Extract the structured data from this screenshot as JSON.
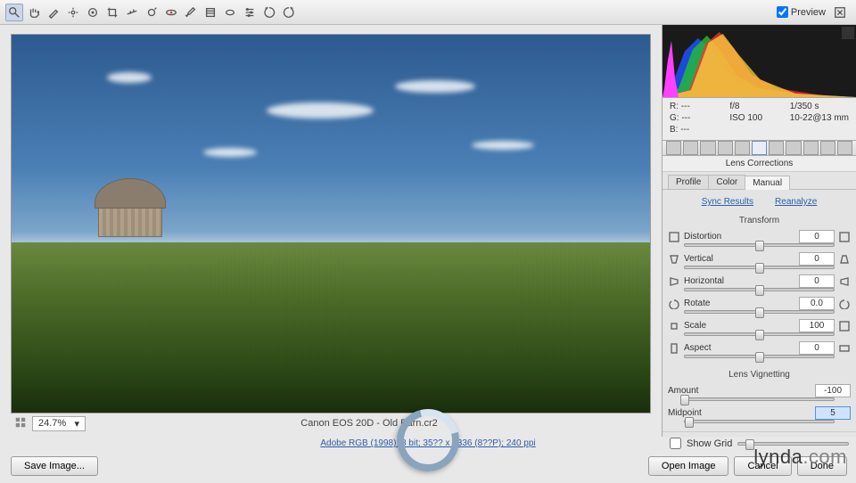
{
  "toolbar": {
    "preview_checkbox": "Preview"
  },
  "exif": {
    "r": "R:  ---",
    "g": "G:  ---",
    "b": "B:  ---",
    "aperture": "f/8",
    "shutter": "1/350 s",
    "iso": "ISO 100",
    "lens": "10-22@13 mm"
  },
  "panel": {
    "title": "Lens Corrections",
    "tabs": {
      "profile": "Profile",
      "color": "Color",
      "manual": "Manual"
    },
    "sync": "Sync Results",
    "reanalyze": "Reanalyze",
    "transform": {
      "heading": "Transform",
      "distortion": {
        "label": "Distortion",
        "value": "0",
        "pos": 50
      },
      "vertical": {
        "label": "Vertical",
        "value": "0",
        "pos": 50
      },
      "horizontal": {
        "label": "Horizontal",
        "value": "0",
        "pos": 50
      },
      "rotate": {
        "label": "Rotate",
        "value": "0.0",
        "pos": 50
      },
      "scale": {
        "label": "Scale",
        "value": "100",
        "pos": 50
      },
      "aspect": {
        "label": "Aspect",
        "value": "0",
        "pos": 50
      }
    },
    "vignetting": {
      "heading": "Lens Vignetting",
      "amount": {
        "label": "Amount",
        "value": "-100",
        "pos": 0
      },
      "midpoint": {
        "label": "Midpoint",
        "value": "5",
        "pos": 3
      }
    },
    "show_grid": "Show Grid"
  },
  "preview": {
    "zoom": "24.7%",
    "camera_file": "Canon EOS 20D  -  Old Barn.cr2",
    "info_link": "Adobe RGB (1998); 8 bit; 35?? x 2336 (8??P); 240 ppi"
  },
  "buttons": {
    "save": "Save Image...",
    "open": "Open Image",
    "cancel": "Cancel",
    "done": "Done"
  },
  "watermark": {
    "brand": "lynda",
    "suffix": ".com"
  }
}
